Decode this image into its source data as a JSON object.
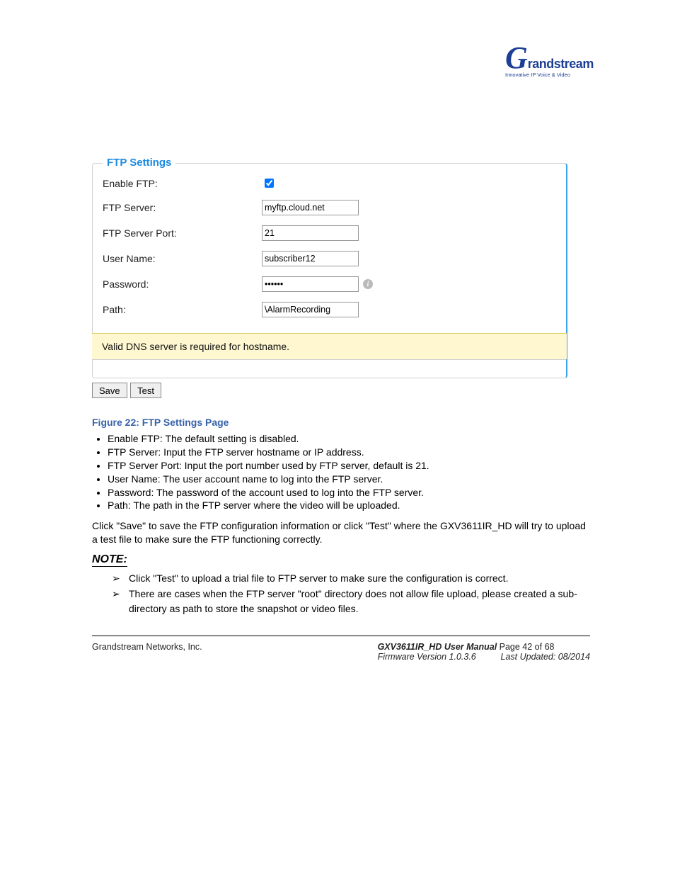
{
  "brand": {
    "mark": "G",
    "name": "randstream",
    "tagline": "Innovative IP Voice & Video"
  },
  "fieldset": {
    "legend": "FTP Settings",
    "enable_ftp_label": "Enable FTP:",
    "enable_ftp_checked": true,
    "ftp_server_label": "FTP Server:",
    "ftp_server_value": "myftp.cloud.net",
    "ftp_port_label": "FTP Server Port:",
    "ftp_port_value": "21",
    "username_label": "User Name:",
    "username_value": "subscriber12",
    "password_label": "Password:",
    "password_value": "••••••",
    "path_label": "Path:",
    "path_value": "\\AlarmRecording",
    "notice": "Valid DNS server is required for hostname.",
    "save_btn": "Save",
    "test_btn": "Test"
  },
  "caption": "Figure 22:  FTP Settings Page",
  "bullets": [
    "Enable FTP:  The default setting is disabled.",
    "FTP Server:  Input the FTP server hostname or IP address.",
    "FTP Server Port:  Input the port number used by FTP server, default is 21.",
    "User Name:  The user account name to log into the FTP server.",
    "Password:  The password of the account used to log into the FTP server.",
    "Path:  The path in the FTP server where the video will be uploaded."
  ],
  "post_text": "Click \"Save\" to save the FTP configuration information or click \"Test\" where the GXV3611IR_HD will try to upload a test file to make sure the FTP functioning correctly.",
  "note_label": "NOTE:",
  "arrows": [
    "Click \"Test\" to upload a trial file to FTP server to make sure the configuration is correct.",
    "There are cases when the FTP server \"root\" directory does not allow file upload, please created a sub-directory as path to store the snapshot or video files."
  ],
  "footer": {
    "left": "Grandstream Networks, Inc.",
    "mid_title": "GXV3611IR_HD User Manual         ",
    "mid_page": "Page 42 of 68",
    "right_fw": "Firmware Version 1.0.3.6",
    "right_up": "Last Updated:  08/2014"
  }
}
